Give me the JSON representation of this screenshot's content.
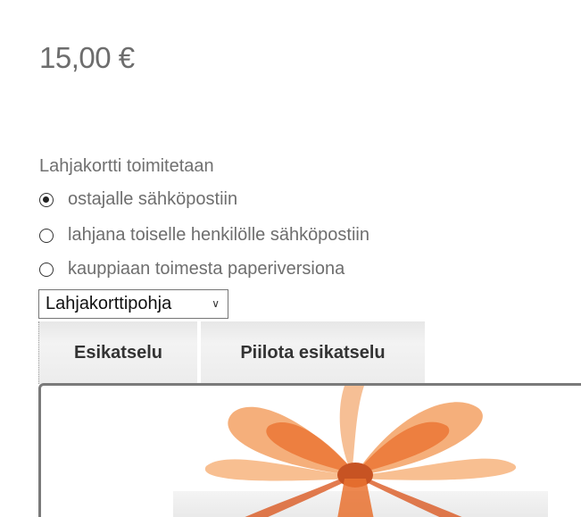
{
  "price": "15,00 €",
  "delivery": {
    "label": "Lahjakortti toimitetaan",
    "options": [
      {
        "label": "ostajalle sähköpostiin",
        "checked": true
      },
      {
        "label": "lahjana toiselle henkilölle sähköpostiin",
        "checked": false
      },
      {
        "label": "kauppiaan toimesta paperiversiona",
        "checked": false
      }
    ]
  },
  "template_select": {
    "value": "Lahjakorttipohja"
  },
  "buttons": {
    "preview": "Esikatselu",
    "hide_preview": "Piilota esikatselu"
  },
  "colors": {
    "ribbon": "#e8641b",
    "ribbon_dark": "#c2410c",
    "ribbon_light": "#f59a52"
  },
  "icons": {
    "select_arrow": "chevron-down-icon"
  }
}
